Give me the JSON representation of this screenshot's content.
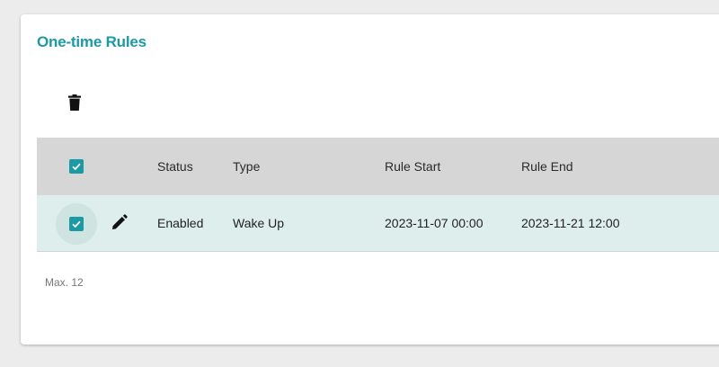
{
  "section": {
    "title": "One-time Rules"
  },
  "toolbar": {
    "delete_icon": "trash-icon"
  },
  "table": {
    "columns": [
      "Status",
      "Type",
      "Rule Start",
      "Rule End"
    ],
    "select_all_checked": true,
    "rows": [
      {
        "checked": true,
        "status": "Enabled",
        "type": "Wake Up",
        "rule_start": "2023-11-07 00:00",
        "rule_end": "2023-11-21 12:00"
      }
    ]
  },
  "footer": {
    "note": "Max. 12"
  },
  "colors": {
    "accent": "#1b9aa6",
    "header_bg": "#d6d6d6",
    "selected_row_bg": "#ddeeed"
  }
}
